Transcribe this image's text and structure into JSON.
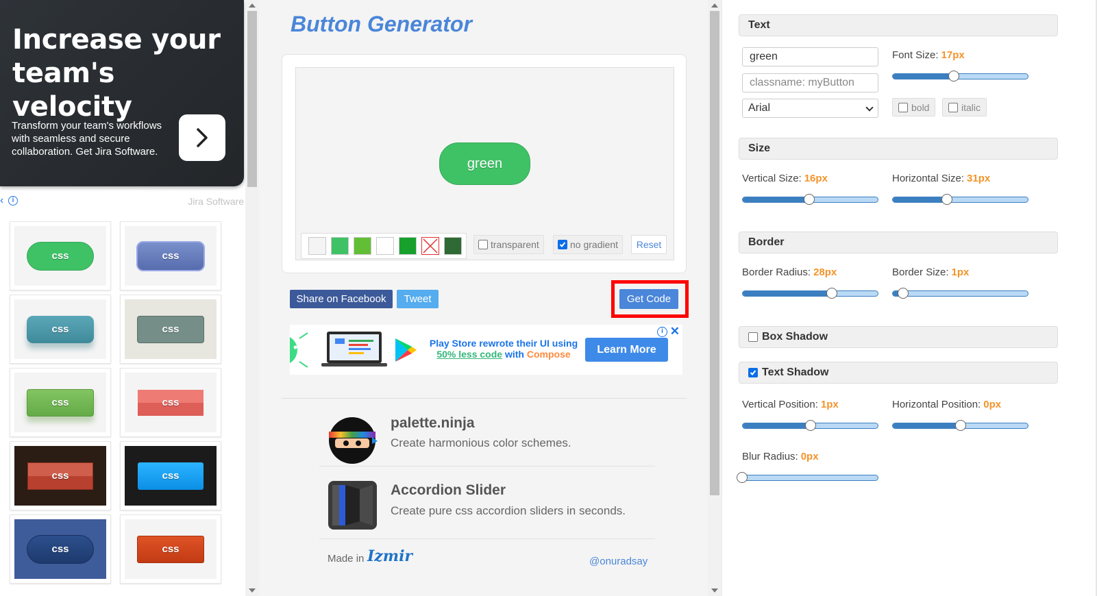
{
  "left_ad": {
    "title": "Increase your team's velocity",
    "body": "Transform your team's workflows with seamless and secure collaboration. Get Jira Software.",
    "brand": "Jira Software",
    "arrow_icon": "chevron-right-icon",
    "info_icon": "info-icon"
  },
  "gallery": {
    "items": [
      {
        "label": "css",
        "bg": "#3fc266",
        "style": "pill"
      },
      {
        "label": "css",
        "bg": "#6279b8",
        "style": "rounded-gloss"
      },
      {
        "label": "css",
        "bg": "#4e9aaa",
        "style": "rounded-shadow"
      },
      {
        "label": "css",
        "bg": "#758f88",
        "style": "rect-outline"
      },
      {
        "label": "css",
        "bg": "#74b857",
        "style": "rect-shadow"
      },
      {
        "label": "css",
        "bg": "#e46a63",
        "style": "flat"
      },
      {
        "label": "css",
        "bg": "#c5513f",
        "style": "dark-bg"
      },
      {
        "label": "css",
        "bg": "#1da7f3",
        "style": "dark-bg-blue"
      },
      {
        "label": "css",
        "bg": "#22447a",
        "style": "pill-on-blue"
      },
      {
        "label": "css",
        "bg": "#d0401c",
        "style": "rect"
      }
    ]
  },
  "app": {
    "title": "Button Generator"
  },
  "preview": {
    "button_label": "green",
    "button_color": "#3fc266",
    "swatches": [
      "#f4f4f4",
      "#3fc266",
      "#62bf35",
      "#ffffff",
      "#17a02c",
      "none",
      "#2f6a34"
    ],
    "transparent_label": "transparent",
    "transparent_checked": false,
    "no_gradient_label": "no gradient",
    "no_gradient_checked": true,
    "reset_label": "Reset"
  },
  "share": {
    "facebook_label": "Share on Facebook",
    "tweet_label": "Tweet",
    "get_code_label": "Get Code"
  },
  "promo": {
    "text_prefix": "Play Store rewrote their UI using",
    "text_highlight": "50% less code",
    "text_mid": "with",
    "text_brand": "Compose",
    "cta": "Learn More"
  },
  "related": [
    {
      "title": "palette.ninja",
      "desc": "Create harmonious color schemes."
    },
    {
      "title": "Accordion Slider",
      "desc": "Create pure css accordion sliders in seconds."
    }
  ],
  "footer": {
    "made_in": "Made in",
    "made_logo": "Izmir",
    "handle": "@onuradsay"
  },
  "settings": {
    "text_section": "Text",
    "text_value": "green",
    "classname_placeholder": "classname: myButton",
    "font_family": "Arial",
    "font_size_label": "Font Size:",
    "font_size_value": "17px",
    "font_size_fraction": 0.45,
    "bold_label": "bold",
    "bold_checked": false,
    "italic_label": "italic",
    "italic_checked": false,
    "size_section": "Size",
    "vertical_size_label": "Vertical Size:",
    "vertical_size_value": "16px",
    "vertical_size_fraction": 0.49,
    "horizontal_size_label": "Horizontal Size:",
    "horizontal_size_value": "31px",
    "horizontal_size_fraction": 0.4,
    "border_section": "Border",
    "border_radius_label": "Border Radius:",
    "border_radius_value": "28px",
    "border_radius_fraction": 0.66,
    "border_size_label": "Border Size:",
    "border_size_value": "1px",
    "border_size_fraction": 0.08,
    "box_shadow_label": "Box Shadow",
    "box_shadow_checked": false,
    "text_shadow_label": "Text Shadow",
    "text_shadow_checked": true,
    "vertical_position_label": "Vertical Position:",
    "vertical_position_value": "1px",
    "vertical_position_fraction": 0.5,
    "horizontal_position_label": "Horizontal Position:",
    "horizontal_position_value": "0px",
    "horizontal_position_fraction": 0.5,
    "blur_radius_label": "Blur Radius:",
    "blur_radius_value": "0px",
    "blur_radius_fraction": 0.0
  },
  "colors": {
    "accent": "#4a86d9",
    "value_orange": "#f4932a",
    "highlight_frame": "#ff0000"
  }
}
